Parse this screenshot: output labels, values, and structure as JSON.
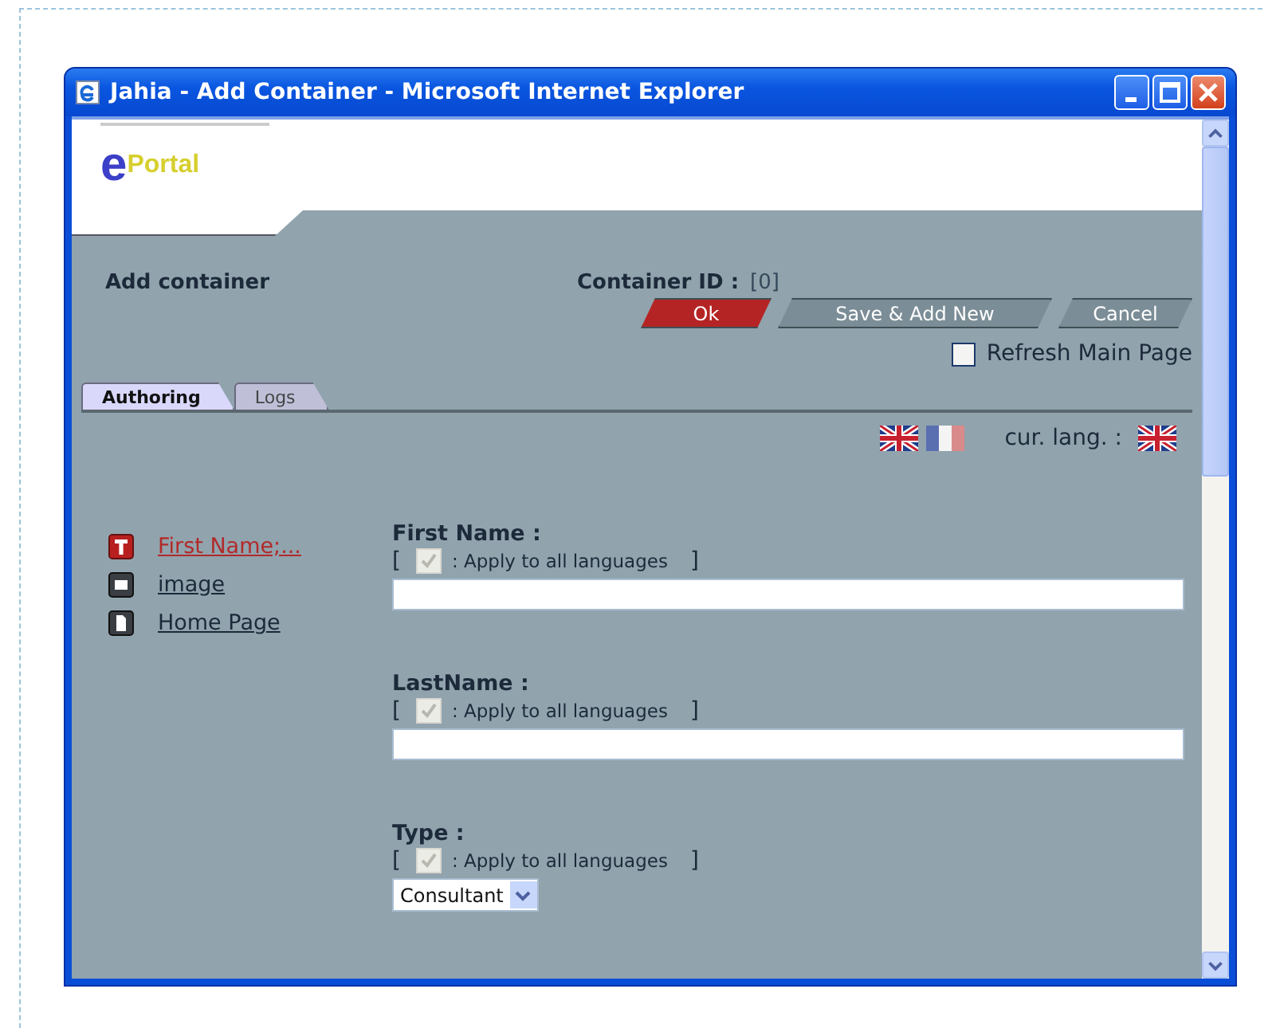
{
  "window": {
    "title": "Jahia - Add Container - Microsoft Internet Explorer"
  },
  "logo": {
    "text_e": "e",
    "text_rest": "Portal"
  },
  "header": {
    "title": "Add container",
    "id_label": "Container ID :",
    "id_value": "[0]"
  },
  "buttons": [
    {
      "label": "Ok",
      "kind": "primary"
    },
    {
      "label": "Save & Add New",
      "kind": "normal"
    },
    {
      "label": "Cancel",
      "kind": "normal"
    }
  ],
  "refresh": {
    "label": "Refresh Main Page",
    "checked": false
  },
  "tabs": [
    {
      "label": "Authoring",
      "selected": true
    },
    {
      "label": "Logs",
      "selected": false
    }
  ],
  "languages": {
    "flags": [
      {
        "kind": "uk"
      },
      {
        "kind": "fr"
      }
    ],
    "current_label": "cur. lang. :",
    "current_flag": {
      "kind": "uk"
    }
  },
  "sidebar": {
    "items": [
      {
        "label": "First Name;...",
        "kind": "text",
        "selected": true
      },
      {
        "label": "image",
        "kind": "image",
        "selected": false
      },
      {
        "label": "Home Page",
        "kind": "page",
        "selected": false
      }
    ]
  },
  "fields": [
    {
      "label": "First Name :",
      "kind": "text",
      "bracket_open": "[",
      "apply_label": ": Apply to all languages",
      "bracket_close": "]",
      "apply_checked": true
    },
    {
      "label": "LastName :",
      "kind": "text",
      "bracket_open": "[",
      "apply_label": ": Apply to all languages",
      "bracket_close": "]",
      "apply_checked": true
    },
    {
      "label": "Type :",
      "kind": "select",
      "bracket_open": "[",
      "apply_label": ": Apply to all languages",
      "bracket_close": "]",
      "apply_checked": true,
      "value": "Consultant"
    }
  ]
}
